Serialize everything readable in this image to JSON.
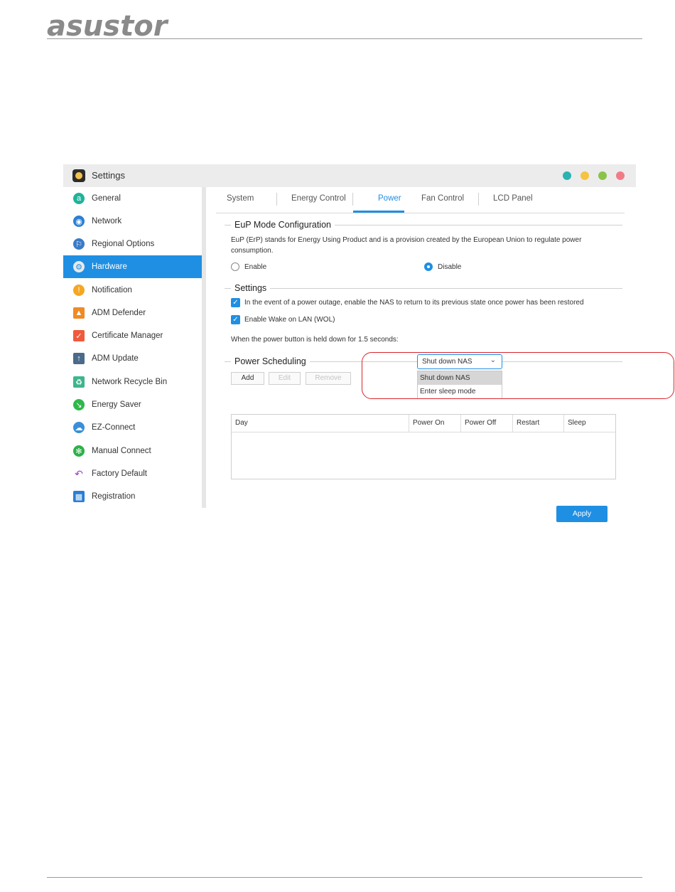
{
  "doc": {
    "brand": "asustor"
  },
  "window": {
    "title": "Settings",
    "dot_colors": [
      "#2bb3b0",
      "#f5c342",
      "#8bc34a",
      "#f07b86"
    ]
  },
  "sidebar": {
    "items": [
      {
        "label": "General",
        "icon": "general-icon",
        "color": "#1fb39a"
      },
      {
        "label": "Network",
        "icon": "globe-icon",
        "color": "#2a7fd4"
      },
      {
        "label": "Regional Options",
        "icon": "regional-icon",
        "color": "#3a7bc8"
      },
      {
        "label": "Hardware",
        "icon": "hardware-icon",
        "color": "#e8e8e8",
        "active": true
      },
      {
        "label": "Notification",
        "icon": "notification-icon",
        "color": "#f5a623"
      },
      {
        "label": "ADM Defender",
        "icon": "firewall-icon",
        "color": "#f08a24"
      },
      {
        "label": "Certificate Manager",
        "icon": "certificate-icon",
        "color": "#f05a3c"
      },
      {
        "label": "ADM Update",
        "icon": "update-icon",
        "color": "#4a6b8a"
      },
      {
        "label": "Network Recycle Bin",
        "icon": "recycle-bin-icon",
        "color": "#3fb58f"
      },
      {
        "label": "Energy Saver",
        "icon": "energy-icon",
        "color": "#2fb84a"
      },
      {
        "label": "EZ-Connect",
        "icon": "cloud-icon",
        "color": "#3a8fd8"
      },
      {
        "label": "Manual Connect",
        "icon": "manual-connect-icon",
        "color": "#2fb04a"
      },
      {
        "label": "Factory Default",
        "icon": "undo-icon",
        "color": "#9b3fc7"
      },
      {
        "label": "Registration",
        "icon": "registration-icon",
        "color": "#2a7fd4"
      }
    ]
  },
  "tabs": [
    "System",
    "Energy Control",
    "Power",
    "Fan Control",
    "LCD Panel"
  ],
  "eup": {
    "title": "EuP Mode Configuration",
    "description_line1": "EuP (ErP) stands for Energy Using Product and is a provision created by the European Union to regulate power",
    "description_line2": "consumption.",
    "enable_label": "Enable",
    "disable_label": "Disable",
    "selected": "Disable"
  },
  "settings": {
    "title": "Settings",
    "power_restore_label": "In the event of a power outage, enable the NAS to return to its previous state once power has been restored",
    "wol_label": "Enable Wake on LAN (WOL)",
    "power_button_label": "When the power button is held down for 1.5 seconds:",
    "power_button_value": "Shut down NAS",
    "power_button_options": [
      "Shut down NAS",
      "Enter sleep mode"
    ]
  },
  "scheduling": {
    "title": "Power Scheduling",
    "add_label": "Add",
    "edit_label": "Edit",
    "remove_label": "Remove",
    "columns": [
      "Day",
      "Power On",
      "Power Off",
      "Restart",
      "Sleep"
    ]
  },
  "apply_label": "Apply"
}
